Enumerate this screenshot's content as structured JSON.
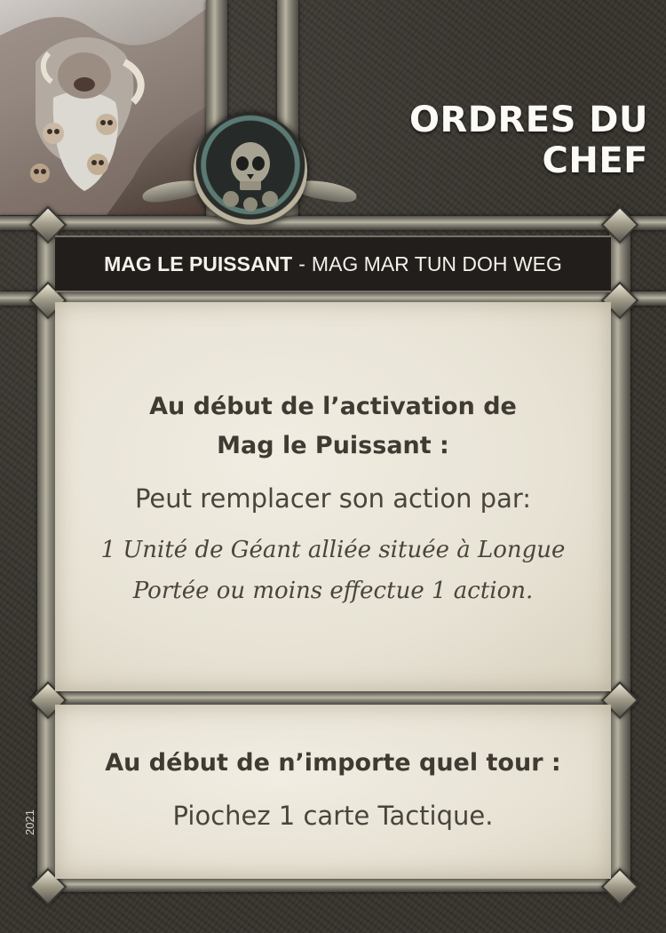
{
  "card": {
    "title": "ORDRES DU CHEF",
    "name_bold": "MAG LE PUISSANT",
    "name_separator": "-",
    "name_alt": "MAG MAR TUN DOH WEG",
    "year": "2021",
    "icons": [
      "portrait-image",
      "skull-emblem"
    ]
  },
  "ability1": {
    "trigger_line1": "Au début de l’activation de",
    "trigger_line2": "Mag le Puissant :",
    "action": "Peut remplacer son action par:",
    "effect_line1": "1 Unité de Géant alliée située à Longue",
    "effect_line2": "Portée ou moins effectue 1 action."
  },
  "ability2": {
    "trigger": "Au début de n’importe quel tour :",
    "effect": "Piochez 1 carte Tactique."
  }
}
